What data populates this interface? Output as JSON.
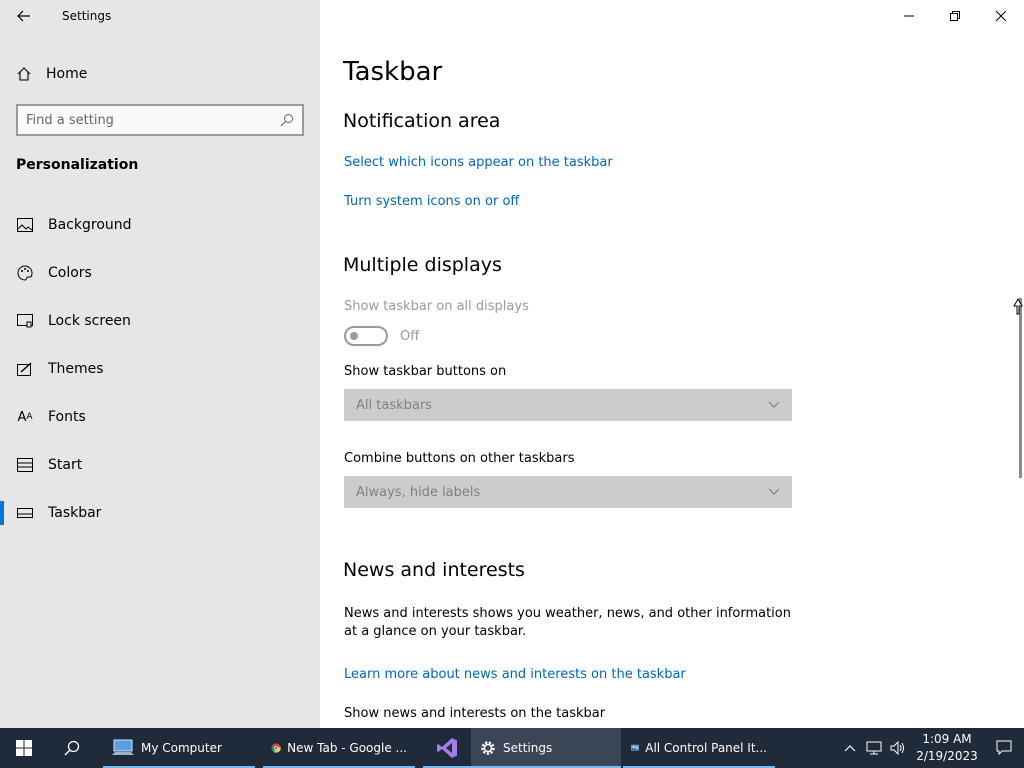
{
  "window": {
    "app_title": "Settings"
  },
  "sidebar": {
    "home_label": "Home",
    "search_placeholder": "Find a setting",
    "section_label": "Personalization",
    "items": [
      {
        "label": "Background",
        "icon": "image-icon"
      },
      {
        "label": "Colors",
        "icon": "palette-icon"
      },
      {
        "label": "Lock screen",
        "icon": "lock-screen-icon"
      },
      {
        "label": "Themes",
        "icon": "themes-icon"
      },
      {
        "label": "Fonts",
        "icon": "fonts-icon"
      },
      {
        "label": "Start",
        "icon": "start-icon"
      },
      {
        "label": "Taskbar",
        "icon": "taskbar-icon",
        "active": true
      }
    ]
  },
  "main": {
    "page_title": "Taskbar",
    "notification_area": {
      "heading": "Notification area",
      "link1": "Select which icons appear on the taskbar",
      "link2": "Turn system icons on or off"
    },
    "multiple_displays": {
      "heading": "Multiple displays",
      "show_on_all_label": "Show taskbar on all displays",
      "toggle_state": "Off",
      "buttons_on_label": "Show taskbar buttons on",
      "buttons_on_value": "All taskbars",
      "combine_label": "Combine buttons on other taskbars",
      "combine_value": "Always, hide labels"
    },
    "news": {
      "heading": "News and interests",
      "description": "News and interests shows you weather, news, and other information at a glance on your taskbar.",
      "learn_more_link": "Learn more about news and interests on the taskbar",
      "show_label": "Show news and interests on the taskbar"
    }
  },
  "taskbar": {
    "apps": [
      {
        "label": "My Computer",
        "icon": "computer-icon"
      },
      {
        "label": "New Tab - Google ...",
        "icon": "chrome-icon"
      },
      {
        "label": "",
        "icon": "visual-studio-icon"
      },
      {
        "label": "Settings",
        "icon": "gear-icon"
      },
      {
        "label": "All Control Panel It...",
        "icon": "control-panel-icon"
      }
    ],
    "time": "1:09 AM",
    "date": "2/19/2023"
  },
  "colors": {
    "accent": "#0078d7",
    "link": "#0067b8",
    "sidebar_bg": "#e6e6e6",
    "taskbar_bg": "#1f2a3a"
  }
}
